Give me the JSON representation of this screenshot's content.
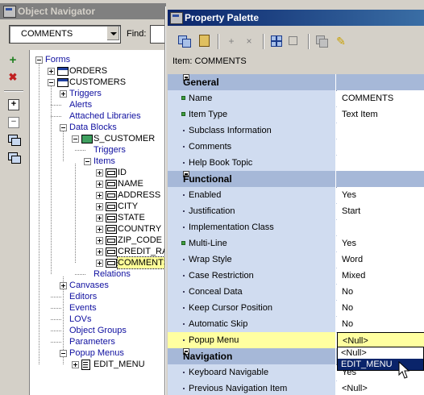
{
  "navigator": {
    "title": "Object Navigator",
    "component_select": "COMMENTS",
    "find_label": "Find:",
    "toolbar": [
      "add-icon",
      "delete-icon",
      "expand-icon",
      "collapse-icon",
      "expand-all-icon",
      "collapse-all-icon"
    ],
    "tree": [
      {
        "label": "Forms",
        "depth": 0,
        "state": "open",
        "icon": "",
        "blue": true
      },
      {
        "label": "ORDERS",
        "depth": 1,
        "state": "closed",
        "icon": "form",
        "blue": false
      },
      {
        "label": "CUSTOMERS",
        "depth": 1,
        "state": "open",
        "icon": "form",
        "blue": false
      },
      {
        "label": "Triggers",
        "depth": 2,
        "state": "closed",
        "icon": "",
        "blue": true
      },
      {
        "label": "Alerts",
        "depth": 2,
        "state": "none",
        "icon": "",
        "blue": true
      },
      {
        "label": "Attached Libraries",
        "depth": 2,
        "state": "none",
        "icon": "",
        "blue": true
      },
      {
        "label": "Data Blocks",
        "depth": 2,
        "state": "open",
        "icon": "",
        "blue": true
      },
      {
        "label": "S_CUSTOMER",
        "depth": 3,
        "state": "open",
        "icon": "block",
        "blue": false
      },
      {
        "label": "Triggers",
        "depth": 4,
        "state": "none",
        "icon": "",
        "blue": true
      },
      {
        "label": "Items",
        "depth": 4,
        "state": "open",
        "icon": "",
        "blue": true
      },
      {
        "label": "ID",
        "depth": 5,
        "state": "closed",
        "icon": "item",
        "blue": false
      },
      {
        "label": "NAME",
        "depth": 5,
        "state": "closed",
        "icon": "item",
        "blue": false
      },
      {
        "label": "ADDRESS",
        "depth": 5,
        "state": "closed",
        "icon": "item",
        "blue": false
      },
      {
        "label": "CITY",
        "depth": 5,
        "state": "closed",
        "icon": "item",
        "blue": false
      },
      {
        "label": "STATE",
        "depth": 5,
        "state": "closed",
        "icon": "item",
        "blue": false
      },
      {
        "label": "COUNTRY",
        "depth": 5,
        "state": "closed",
        "icon": "item",
        "blue": false
      },
      {
        "label": "ZIP_CODE",
        "depth": 5,
        "state": "closed",
        "icon": "item",
        "blue": false
      },
      {
        "label": "CREDIT_RAT",
        "depth": 5,
        "state": "closed",
        "icon": "item",
        "blue": false
      },
      {
        "label": "COMMENTS",
        "depth": 5,
        "state": "closed",
        "icon": "item",
        "blue": false,
        "selected": true
      },
      {
        "label": "Relations",
        "depth": 4,
        "state": "none",
        "icon": "",
        "blue": true
      },
      {
        "label": "Canvases",
        "depth": 2,
        "state": "closed",
        "icon": "",
        "blue": true
      },
      {
        "label": "Editors",
        "depth": 2,
        "state": "none",
        "icon": "",
        "blue": true
      },
      {
        "label": "Events",
        "depth": 2,
        "state": "none",
        "icon": "",
        "blue": true
      },
      {
        "label": "LOVs",
        "depth": 2,
        "state": "none",
        "icon": "",
        "blue": true
      },
      {
        "label": "Object Groups",
        "depth": 2,
        "state": "none",
        "icon": "",
        "blue": true
      },
      {
        "label": "Parameters",
        "depth": 2,
        "state": "none",
        "icon": "",
        "blue": true
      },
      {
        "label": "Popup Menus",
        "depth": 2,
        "state": "open",
        "icon": "",
        "blue": true
      },
      {
        "label": "EDIT_MENU",
        "depth": 3,
        "state": "closed",
        "icon": "menu",
        "blue": false
      }
    ]
  },
  "palette": {
    "title": "Property Palette",
    "item_label": "Item: COMMENTS",
    "toolbar": [
      "copy-properties-icon",
      "paste-properties-icon",
      "add-property-icon",
      "delete-property-icon",
      "intersection-icon",
      "union-icon",
      "freeze-icon",
      "pin-icon"
    ],
    "rows": [
      {
        "type": "category",
        "name": "General"
      },
      {
        "type": "prop",
        "name": "Name",
        "value": "COMMENTS",
        "bullet": "green"
      },
      {
        "type": "prop",
        "name": "Item Type",
        "value": "Text Item",
        "bullet": "green"
      },
      {
        "type": "prop",
        "name": "Subclass Information",
        "value": "",
        "bullet": "dot"
      },
      {
        "type": "prop",
        "name": "Comments",
        "value": "",
        "bullet": "dot"
      },
      {
        "type": "prop",
        "name": "Help Book Topic",
        "value": "",
        "bullet": "dot"
      },
      {
        "type": "category",
        "name": "Functional"
      },
      {
        "type": "prop",
        "name": "Enabled",
        "value": "Yes",
        "bullet": "dot"
      },
      {
        "type": "prop",
        "name": "Justification",
        "value": "Start",
        "bullet": "dot"
      },
      {
        "type": "prop",
        "name": "Implementation Class",
        "value": "",
        "bullet": "dot"
      },
      {
        "type": "prop",
        "name": "Multi-Line",
        "value": "Yes",
        "bullet": "green"
      },
      {
        "type": "prop",
        "name": "Wrap Style",
        "value": "Word",
        "bullet": "dot"
      },
      {
        "type": "prop",
        "name": "Case Restriction",
        "value": "Mixed",
        "bullet": "dot"
      },
      {
        "type": "prop",
        "name": "Conceal Data",
        "value": "No",
        "bullet": "dot"
      },
      {
        "type": "prop",
        "name": "Keep Cursor Position",
        "value": "No",
        "bullet": "dot"
      },
      {
        "type": "prop",
        "name": "Automatic Skip",
        "value": "No",
        "bullet": "dot"
      },
      {
        "type": "prop",
        "name": "Popup Menu",
        "value": "<Null>",
        "bullet": "dot",
        "highlight": true
      },
      {
        "type": "category",
        "name": "Navigation"
      },
      {
        "type": "prop",
        "name": "Keyboard Navigable",
        "value": "Yes",
        "bullet": "dot"
      },
      {
        "type": "prop",
        "name": "Previous Navigation Item",
        "value": "<Null>",
        "bullet": "dot"
      }
    ],
    "dropdown_options": [
      "<Null>",
      "EDIT_MENU"
    ],
    "dropdown_selected": 1
  },
  "colors": {
    "titlebar_active": "#0a246a",
    "titlebar_inactive": "#808080",
    "category_bg": "#a6b8d8",
    "name_bg": "#d0dcf0",
    "highlight_bg": "#ffffa0",
    "tree_link": "#1010a0"
  }
}
